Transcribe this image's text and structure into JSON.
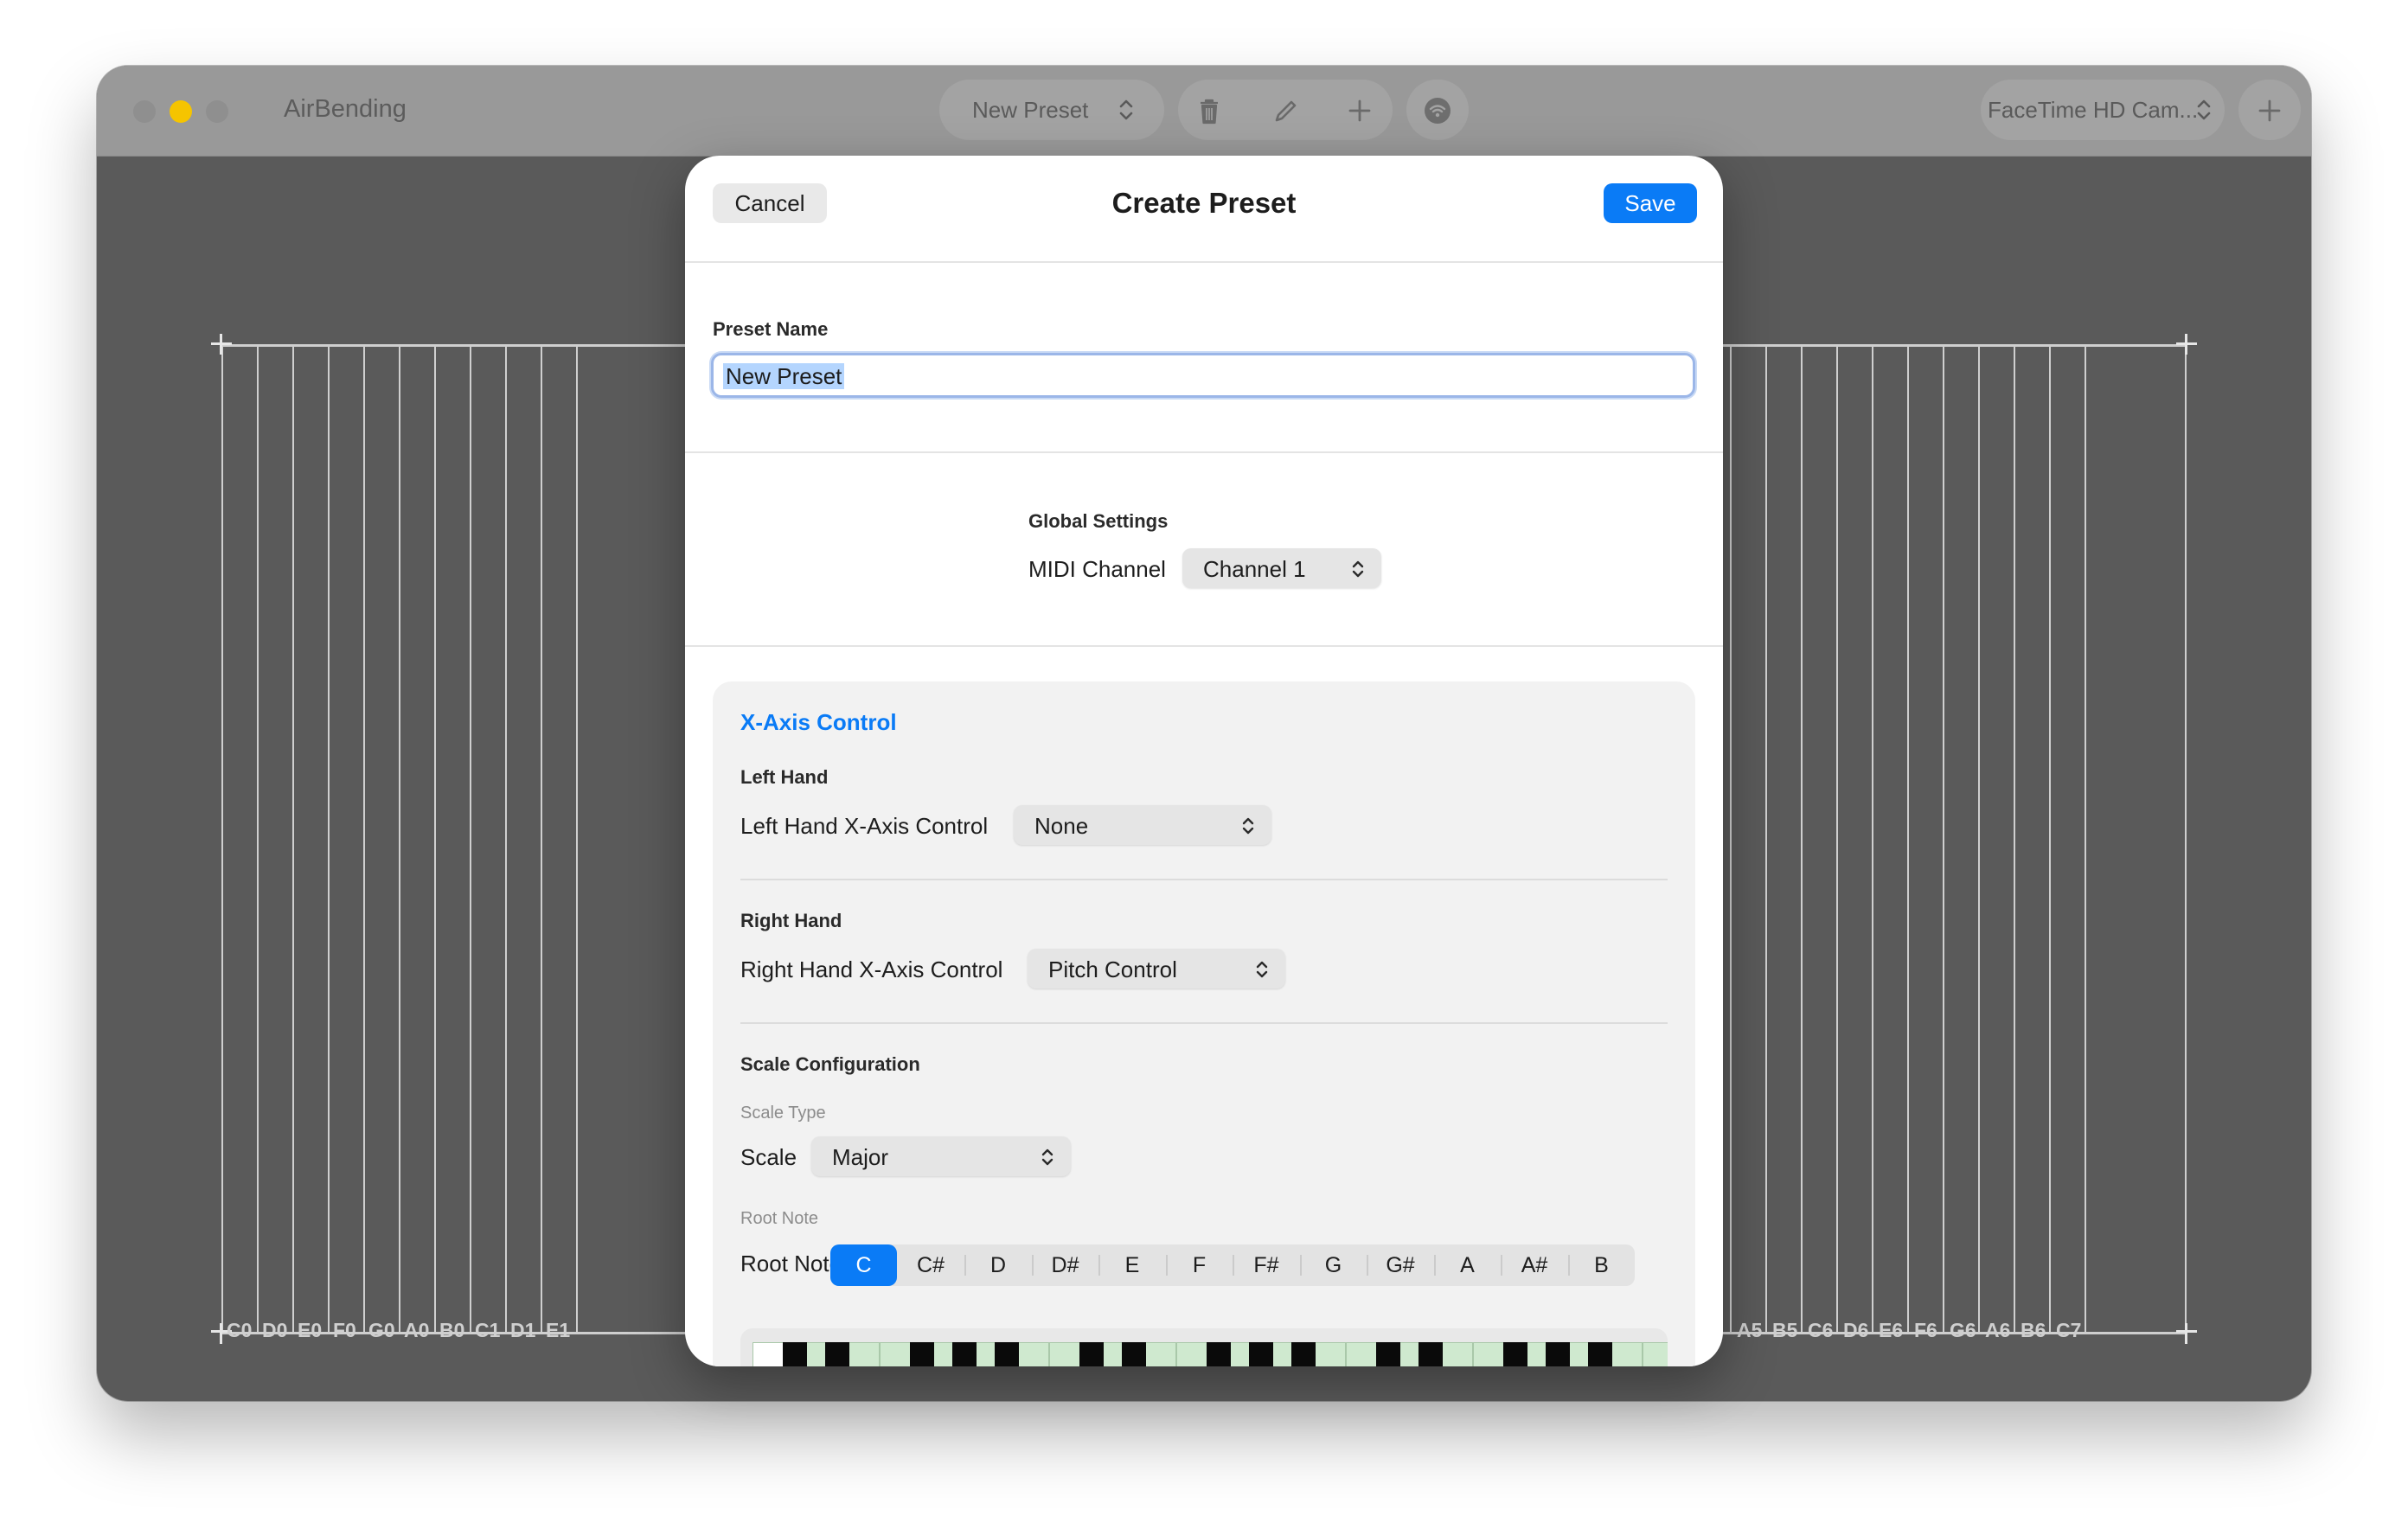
{
  "window": {
    "app_title": "AirBending",
    "preset_selector": {
      "label": "New Preset"
    },
    "toolbar": {
      "delete_icon": "trash-icon",
      "edit_icon": "pencil-icon",
      "add_icon": "plus-icon",
      "broadcast_icon": "wifi-icon"
    },
    "camera_selector": {
      "label": "FaceTime HD Cam..."
    },
    "add_camera_icon": "plus-icon",
    "colors": {
      "titlebar": "#999999",
      "background": "#5a5a5a",
      "minimize": "#f5c400"
    }
  },
  "note_grid": {
    "left_labels": [
      "C0",
      "D0",
      "E0",
      "F0",
      "G0",
      "A0",
      "B0",
      "C1",
      "D1",
      "E1"
    ],
    "right_labels": [
      "A5",
      "B5",
      "C6",
      "D6",
      "E6",
      "F6",
      "G6",
      "A6",
      "B6",
      "C7"
    ]
  },
  "sheet": {
    "title": "Create Preset",
    "cancel_label": "Cancel",
    "save_label": "Save",
    "preset_name": {
      "label": "Preset Name",
      "value": "New Preset"
    },
    "global_settings": {
      "heading": "Global Settings",
      "midi_channel_label": "MIDI Channel",
      "midi_channel_value": "Channel 1"
    },
    "x_axis": {
      "title": "X-Axis Control",
      "left_hand": {
        "heading": "Left Hand",
        "label": "Left Hand X-Axis Control",
        "value": "None"
      },
      "right_hand": {
        "heading": "Right Hand",
        "label": "Right Hand X-Axis Control",
        "value": "Pitch Control"
      },
      "scale": {
        "heading": "Scale Configuration",
        "scale_type_caption": "Scale Type",
        "scale_label": "Scale",
        "scale_value": "Major",
        "root_note_caption": "Root Note",
        "root_note_label": "Root Note",
        "root_notes": [
          "C",
          "C#",
          "D",
          "D#",
          "E",
          "F",
          "F#",
          "G",
          "G#",
          "A",
          "A#",
          "B"
        ],
        "selected_root": "C"
      }
    },
    "colors": {
      "accent": "#0a7bf6",
      "scale_key_highlight": "#cfe9cf"
    }
  }
}
